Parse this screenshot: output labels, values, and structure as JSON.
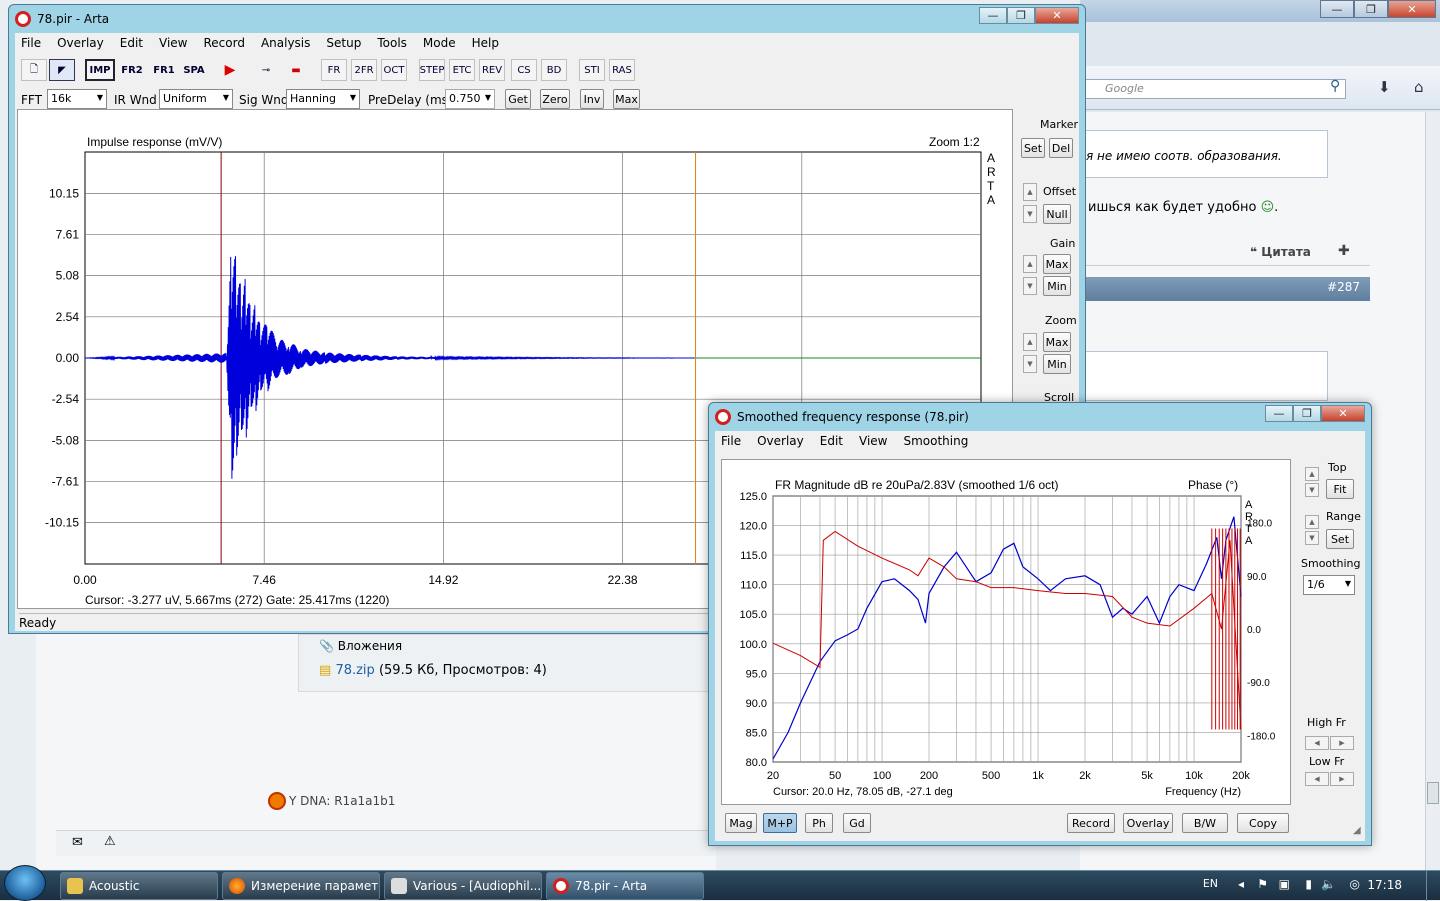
{
  "browser": {
    "search_placeholder": "Google",
    "post_quote": "я не имею соотв. образования.",
    "post_text": "ишься как будет удобно",
    "quote_label": "Цитата",
    "post_number": "#287"
  },
  "forum": {
    "attachments_label": "Вложения",
    "attachment_link": "78.zip",
    "attachment_info": "(59.5 Кб, Просмотров: 4)",
    "signature": "Y DNA: R1a1a1b1"
  },
  "arta": {
    "title": "78.pir - Arta",
    "menu": [
      "File",
      "Overlay",
      "Edit",
      "View",
      "Record",
      "Analysis",
      "Setup",
      "Tools",
      "Mode",
      "Help"
    ],
    "toolbar_buttons": [
      "IMP",
      "FR2",
      "FR1",
      "SPA"
    ],
    "fft_label": "FFT",
    "fft_value": "16k",
    "ir_wnd_label": "IR Wnd",
    "ir_wnd_value": "Uniform",
    "sig_wnd_label": "Sig Wnd",
    "sig_wnd_value": "Hanning",
    "predelay_label": "PreDelay (ms)",
    "predelay_value": "0.750",
    "btn_get": "Get",
    "btn_zero": "Zero",
    "btn_inv": "Inv",
    "btn_max": "Max",
    "plot_title": "Impulse response (mV/V)",
    "zoom_label": "Zoom 1:2",
    "watermark": [
      "A",
      "R",
      "T",
      "A"
    ],
    "cursor_text": "Cursor: -3.277 uV, 5.667ms (272)  Gate: 25.417ms (1220)",
    "status": "Ready",
    "side": {
      "marker": "Marker",
      "set": "Set",
      "del": "Del",
      "offset": "Offset",
      "null": "Null",
      "gain": "Gain",
      "max": "Max",
      "min": "Min",
      "zoom": "Zoom",
      "zmax": "Max",
      "zmin": "Min",
      "scroll": "Scroll"
    }
  },
  "sfr": {
    "title": "Smoothed frequency response (78.pir)",
    "menu": [
      "File",
      "Overlay",
      "Edit",
      "View",
      "Smoothing"
    ],
    "plot_title": "FR Magnitude dB re 20uPa/2.83V (smoothed 1/6 oct)",
    "phase_label": "Phase (°)",
    "watermark": [
      "A",
      "R",
      "T",
      "A"
    ],
    "cursor_text": "Cursor: 20.0 Hz, 78.05 dB, -27.1 deg",
    "x_axis_label": "Frequency (Hz)",
    "side": {
      "top": "Top",
      "fit": "Fit",
      "range": "Range",
      "set": "Set",
      "smoothing": "Smoothing",
      "smoothing_value": "1/6",
      "high_fr": "High Fr",
      "low_fr": "Low Fr"
    },
    "buttons_left": [
      "Mag",
      "M+P",
      "Ph",
      "Gd"
    ],
    "buttons_right": [
      "Record",
      "Overlay",
      "B/W",
      "Copy"
    ]
  },
  "taskbar": {
    "tasks": [
      "Acoustic",
      "Измерение парамет...",
      "Various - [Audiophil...",
      "78.pir - Arta"
    ],
    "lang": "EN",
    "clock": "17:18"
  },
  "chart_data": [
    {
      "type": "line",
      "title": "Impulse response (mV/V)",
      "xlabel": "",
      "ylabel": "",
      "x_ticks": [
        0.0,
        7.46,
        14.92,
        22.38
      ],
      "y_ticks": [
        10.15,
        7.61,
        5.08,
        2.54,
        0.0,
        -2.54,
        -5.08,
        -7.61,
        -10.15
      ],
      "xlim": [
        0,
        37.3
      ],
      "ylim": [
        -12.7,
        12.7
      ],
      "markers": {
        "cursor_ms": 5.667,
        "gate_ms": 25.417
      },
      "series": [
        {
          "x": [
            0,
            5.9,
            6.1,
            6.3,
            6.5,
            6.7,
            6.9,
            7.1,
            7.3,
            7.6,
            8.0,
            8.5,
            9.0,
            10.0,
            11.5,
            13.0,
            15.0,
            20.0,
            25.4
          ],
          "values": [
            0,
            0.3,
            7.6,
            -6.2,
            4.4,
            -5.1,
            3.0,
            -3.4,
            2.0,
            -2.1,
            1.2,
            -1.0,
            0.6,
            -0.35,
            0.2,
            -0.1,
            0.05,
            0.02,
            0
          ]
        }
      ],
      "grid": true
    },
    {
      "type": "line",
      "title": "FR Magnitude dB re 20uPa/2.83V (smoothed 1/6 oct)",
      "xlabel": "Frequency (Hz)",
      "ylabel": "",
      "x_scale": "log",
      "x_ticks": [
        20,
        50,
        100,
        200,
        500,
        1000,
        2000,
        5000,
        10000,
        20000
      ],
      "x_tick_labels": [
        "20",
        "50",
        "100",
        "200",
        "500",
        "1k",
        "2k",
        "5k",
        "10k",
        "20k"
      ],
      "y_ticks": [
        125.0,
        120.0,
        115.0,
        110.0,
        105.0,
        100.0,
        95.0,
        90.0,
        85.0,
        80.0
      ],
      "phase_ticks": [
        180.0,
        90.0,
        0.0,
        -90.0,
        -180.0
      ],
      "ylim": [
        80,
        125
      ],
      "series": [
        {
          "x": [
            20,
            25,
            30,
            40,
            50,
            60,
            70,
            80,
            100,
            120,
            150,
            170,
            190,
            200,
            250,
            300,
            400,
            500,
            600,
            700,
            800,
            1000,
            1200,
            1500,
            2000,
            2500,
            3000,
            3500,
            4000,
            5000,
            6000,
            7000,
            8000,
            10000,
            12000,
            14000,
            15000,
            16000,
            18000,
            20000
          ],
          "values": [
            80.5,
            85,
            90,
            97,
            100.5,
            101.5,
            102.5,
            106,
            110.5,
            111,
            109,
            107.5,
            103.5,
            108.5,
            113,
            115.5,
            110.5,
            112,
            116,
            117,
            113,
            111,
            109,
            111,
            111.5,
            110,
            104.5,
            106,
            105,
            108,
            103.5,
            108,
            110,
            109,
            113.5,
            118,
            111,
            117.5,
            121.5,
            108
          ]
        },
        {
          "x": [
            20,
            30,
            40,
            42,
            50,
            70,
            100,
            150,
            170,
            200,
            250,
            300,
            400,
            500,
            700,
            1000,
            1500,
            2000,
            3000,
            4000,
            5000,
            7000,
            10000,
            13000,
            15000,
            17000,
            20000
          ],
          "values": [
            -24,
            -45,
            -65,
            150,
            165,
            140,
            120,
            100,
            90,
            120,
            105,
            85,
            80,
            70,
            70,
            65,
            60,
            60,
            55,
            20,
            10,
            5,
            35,
            60,
            0,
            150,
            -170
          ]
        }
      ],
      "grid": true
    }
  ]
}
